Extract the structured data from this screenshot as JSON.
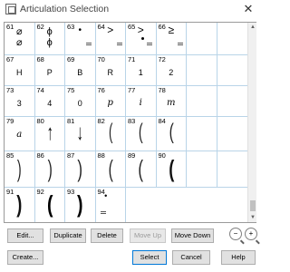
{
  "window": {
    "title": "Articulation Selection",
    "close_glyph": "✕"
  },
  "cells": [
    {
      "num": "61",
      "glyph": "⌀\n⌀"
    },
    {
      "num": "62",
      "glyph": "ϕ\nϕ"
    },
    {
      "num": "63",
      "glyph": "•"
    },
    {
      "num": "64",
      "glyph": ">"
    },
    {
      "num": "65",
      "glyph": ">"
    },
    {
      "num": "66",
      "glyph": "≥"
    },
    {
      "num": "67",
      "glyph": "H"
    },
    {
      "num": "68",
      "glyph": "P"
    },
    {
      "num": "69",
      "glyph": "B"
    },
    {
      "num": "70",
      "glyph": "R"
    },
    {
      "num": "71",
      "glyph": "1"
    },
    {
      "num": "72",
      "glyph": "2"
    },
    {
      "num": "73",
      "glyph": "3"
    },
    {
      "num": "74",
      "glyph": "4"
    },
    {
      "num": "75",
      "glyph": "0"
    },
    {
      "num": "76",
      "glyph": "p"
    },
    {
      "num": "77",
      "glyph": "i"
    },
    {
      "num": "78",
      "glyph": "m"
    },
    {
      "num": "79",
      "glyph": "a"
    },
    {
      "num": "80",
      "glyph": "↑"
    },
    {
      "num": "81",
      "glyph": "↓"
    },
    {
      "num": "82",
      "glyph": "("
    },
    {
      "num": "83",
      "glyph": "("
    },
    {
      "num": "84",
      "glyph": "("
    },
    {
      "num": "85",
      "glyph": ")"
    },
    {
      "num": "86",
      "glyph": ")"
    },
    {
      "num": "87",
      "glyph": ")"
    },
    {
      "num": "88",
      "glyph": "("
    },
    {
      "num": "89",
      "glyph": "("
    },
    {
      "num": "90",
      "glyph": "("
    },
    {
      "num": "91",
      "glyph": ")"
    },
    {
      "num": "92",
      "glyph": "("
    },
    {
      "num": "93",
      "glyph": ")"
    },
    {
      "num": "94",
      "glyph": "•"
    }
  ],
  "buttons": {
    "edit": "Edit...",
    "duplicate": "Duplicate",
    "delete": "Delete",
    "move_up": "Move Up",
    "move_down": "Move Down",
    "zoom_out": "−",
    "zoom_in": "+",
    "create": "Create...",
    "select": "Select",
    "cancel": "Cancel",
    "help": "Help"
  },
  "scrollbar": {
    "up_glyph": "▲",
    "down_glyph": "▼"
  }
}
